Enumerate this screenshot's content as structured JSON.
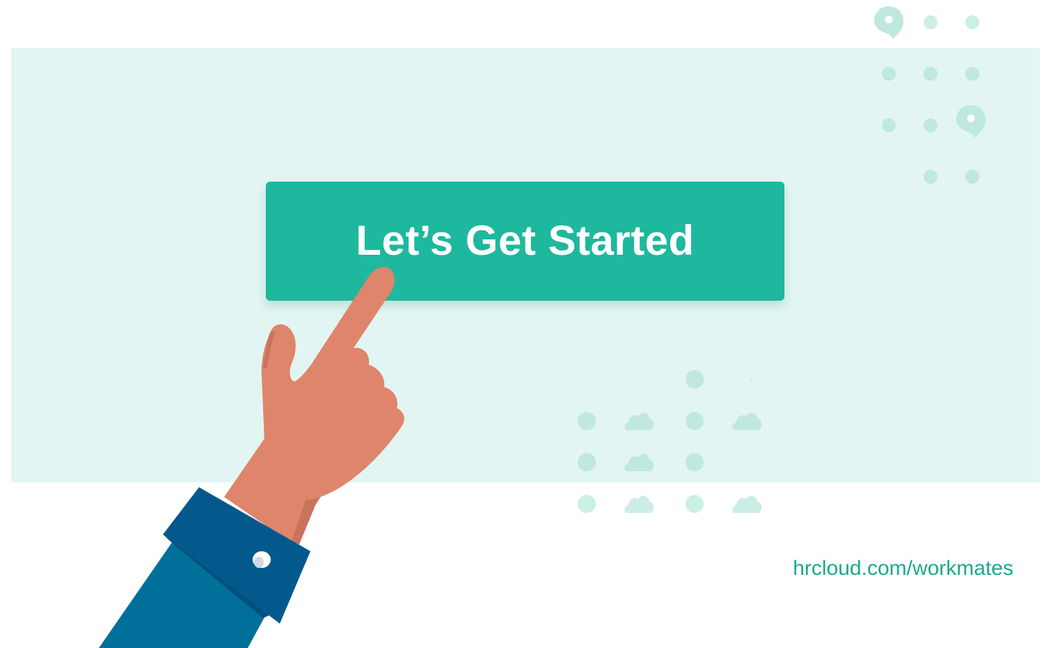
{
  "cta": {
    "label": "Let’s Get Started"
  },
  "footer": {
    "url": "hrcloud.com/workmates"
  },
  "colors": {
    "panel": "#e2f5f2",
    "button": "#1db89d",
    "button_text": "#ffffff",
    "url_text": "#1aa98d",
    "dots": "#bfe8de",
    "skin": "#df856b",
    "cuff": "#04598c",
    "sleeve": "#00709b"
  },
  "icons": [
    "map-pin-icon",
    "cloud-icon",
    "pointing-hand-illustration",
    "cufflink-icon"
  ]
}
